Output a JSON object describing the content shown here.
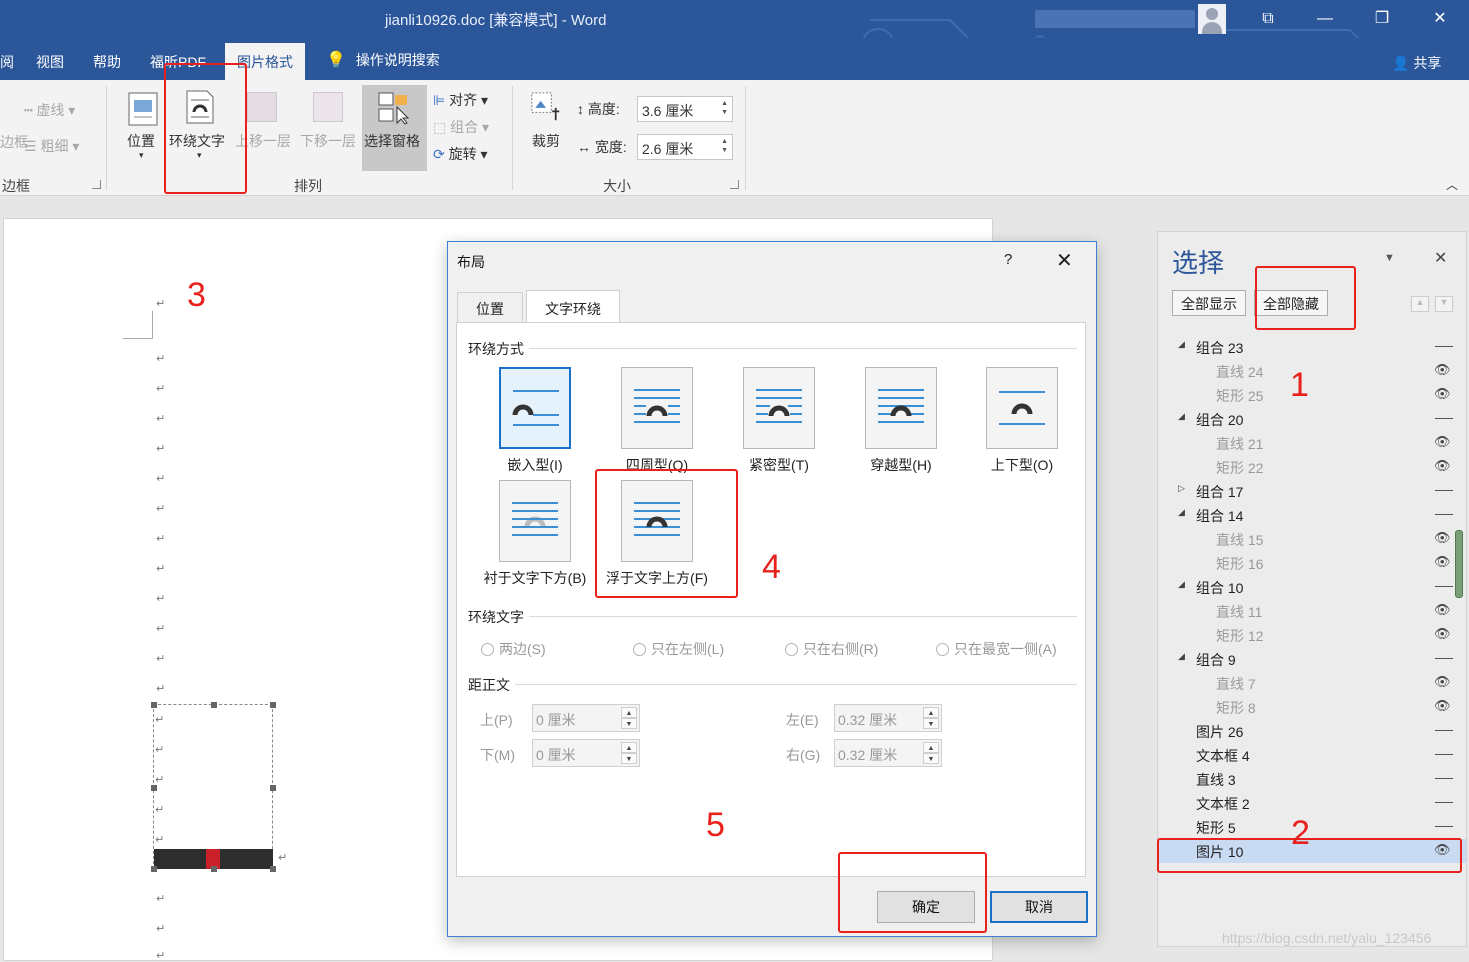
{
  "window": {
    "title": "jianli10926.doc [兼容模式]  -  Word",
    "controls": {
      "restore_ribbon": "⧉",
      "minimize": "—",
      "maximize": "❐",
      "close": "✕"
    }
  },
  "tabs": [
    {
      "label": "阅"
    },
    {
      "label": "视图"
    },
    {
      "label": "帮助"
    },
    {
      "label": "福昕PDF"
    },
    {
      "label": "图片格式"
    },
    {
      "label": "操作说明搜索"
    }
  ],
  "share_label": "共享",
  "ribbon": {
    "border_group": {
      "name": "边框",
      "dash_label": "虚线",
      "weight_label": "粗细",
      "frame_label": "边框"
    },
    "arrange": {
      "name": "排列",
      "position": "位置",
      "wrap_text": "环绕文字",
      "bring_forward": "上移一层",
      "send_backward": "下移一层",
      "selection_pane": "选择窗格",
      "align": "对齐",
      "group": "组合",
      "rotate": "旋转"
    },
    "size": {
      "name": "大小",
      "crop": "裁剪",
      "height_label": "高度:",
      "height_value": "3.6 厘米",
      "width_label": "宽度:",
      "width_value": "2.6 厘米"
    }
  },
  "dialog": {
    "title": "布局",
    "help": "?",
    "close": "✕",
    "tabs": [
      {
        "label": "位置",
        "active": false
      },
      {
        "label": "文字环绕",
        "active": true
      }
    ],
    "wrap_style_header": "环绕方式",
    "wrap_styles": [
      {
        "label": "嵌入型(I)",
        "selected": true
      },
      {
        "label": "四周型(Q)",
        "selected": false
      },
      {
        "label": "紧密型(T)",
        "selected": false
      },
      {
        "label": "穿越型(H)",
        "selected": false
      },
      {
        "label": "上下型(O)",
        "selected": false
      },
      {
        "label": "衬于文字下方(B)",
        "selected": false
      },
      {
        "label": "浮于文字上方(F)",
        "selected": false
      }
    ],
    "wrap_text_header": "环绕文字",
    "wrap_text_options": [
      {
        "label": "两边(S)"
      },
      {
        "label": "只在左侧(L)"
      },
      {
        "label": "只在右侧(R)"
      },
      {
        "label": "只在最宽一侧(A)"
      }
    ],
    "distance_header": "距正文",
    "distance": {
      "top_label": "上(P)",
      "top_value": "0 厘米",
      "bottom_label": "下(M)",
      "bottom_value": "0 厘米",
      "left_label": "左(E)",
      "left_value": "0.32 厘米",
      "right_label": "右(G)",
      "right_value": "0.32 厘米"
    },
    "ok_label": "确定",
    "cancel_label": "取消"
  },
  "selection_pane": {
    "title": "选择",
    "show_all": "全部显示",
    "hide_all": "全部隐藏",
    "items": [
      {
        "label": "组合 23",
        "level": 0,
        "expand": "open",
        "visible": false,
        "dimmed": false
      },
      {
        "label": "直线 24",
        "level": 1,
        "expand": "none",
        "visible": true,
        "dimmed": true
      },
      {
        "label": "矩形 25",
        "level": 1,
        "expand": "none",
        "visible": true,
        "dimmed": true
      },
      {
        "label": "组合 20",
        "level": 0,
        "expand": "open",
        "visible": false,
        "dimmed": false
      },
      {
        "label": "直线 21",
        "level": 1,
        "expand": "none",
        "visible": true,
        "dimmed": true
      },
      {
        "label": "矩形 22",
        "level": 1,
        "expand": "none",
        "visible": true,
        "dimmed": true
      },
      {
        "label": "组合 17",
        "level": 0,
        "expand": "closed",
        "visible": false,
        "dimmed": false
      },
      {
        "label": "组合 14",
        "level": 0,
        "expand": "open",
        "visible": false,
        "dimmed": false
      },
      {
        "label": "直线 15",
        "level": 1,
        "expand": "none",
        "visible": true,
        "dimmed": true
      },
      {
        "label": "矩形 16",
        "level": 1,
        "expand": "none",
        "visible": true,
        "dimmed": true
      },
      {
        "label": "组合 10",
        "level": 0,
        "expand": "open",
        "visible": false,
        "dimmed": false
      },
      {
        "label": "直线 11",
        "level": 1,
        "expand": "none",
        "visible": true,
        "dimmed": true
      },
      {
        "label": "矩形 12",
        "level": 1,
        "expand": "none",
        "visible": true,
        "dimmed": true
      },
      {
        "label": "组合 9",
        "level": 0,
        "expand": "open",
        "visible": false,
        "dimmed": false
      },
      {
        "label": "直线 7",
        "level": 1,
        "expand": "none",
        "visible": true,
        "dimmed": true
      },
      {
        "label": "矩形 8",
        "level": 1,
        "expand": "none",
        "visible": true,
        "dimmed": true
      },
      {
        "label": "图片 26",
        "level": 0,
        "expand": "none",
        "visible": false,
        "dimmed": false
      },
      {
        "label": "文本框 4",
        "level": 0,
        "expand": "none",
        "visible": false,
        "dimmed": false
      },
      {
        "label": "直线 3",
        "level": 0,
        "expand": "none",
        "visible": false,
        "dimmed": false
      },
      {
        "label": "文本框 2",
        "level": 0,
        "expand": "none",
        "visible": false,
        "dimmed": false
      },
      {
        "label": "矩形 5",
        "level": 0,
        "expand": "none",
        "visible": false,
        "dimmed": false
      },
      {
        "label": "图片 10",
        "level": 0,
        "expand": "none",
        "visible": true,
        "dimmed": false,
        "selected": true
      }
    ]
  },
  "annotations": {
    "step1": "1",
    "step2": "2",
    "step3": "3",
    "step4": "4",
    "step5": "5"
  },
  "watermark": "https://blog.csdn.net/yalu_123456",
  "colors": {
    "word_blue": "#2b579a",
    "annotation_red": "#e8211d",
    "selection_blue": "#1a6fc9"
  }
}
